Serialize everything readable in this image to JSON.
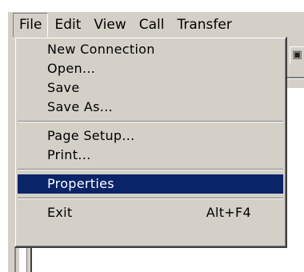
{
  "menubar": {
    "items": [
      {
        "label": "File"
      },
      {
        "label": "Edit"
      },
      {
        "label": "View"
      },
      {
        "label": "Call"
      },
      {
        "label": "Transfer"
      }
    ]
  },
  "file_menu": {
    "group1": [
      {
        "label": "New Connection"
      },
      {
        "label": "Open..."
      },
      {
        "label": "Save"
      },
      {
        "label": "Save As..."
      }
    ],
    "group2": [
      {
        "label": "Page Setup..."
      },
      {
        "label": "Print..."
      }
    ],
    "group3": [
      {
        "label": "Properties",
        "selected": true
      }
    ],
    "group4": [
      {
        "label": "Exit",
        "shortcut": "Alt+F4"
      }
    ]
  },
  "colors": {
    "menu_face": "#d4d0c8",
    "highlight": "#0a246a",
    "highlight_text": "#ffffff"
  },
  "icons": {
    "toolbar_button": "toolbar-button-icon"
  }
}
